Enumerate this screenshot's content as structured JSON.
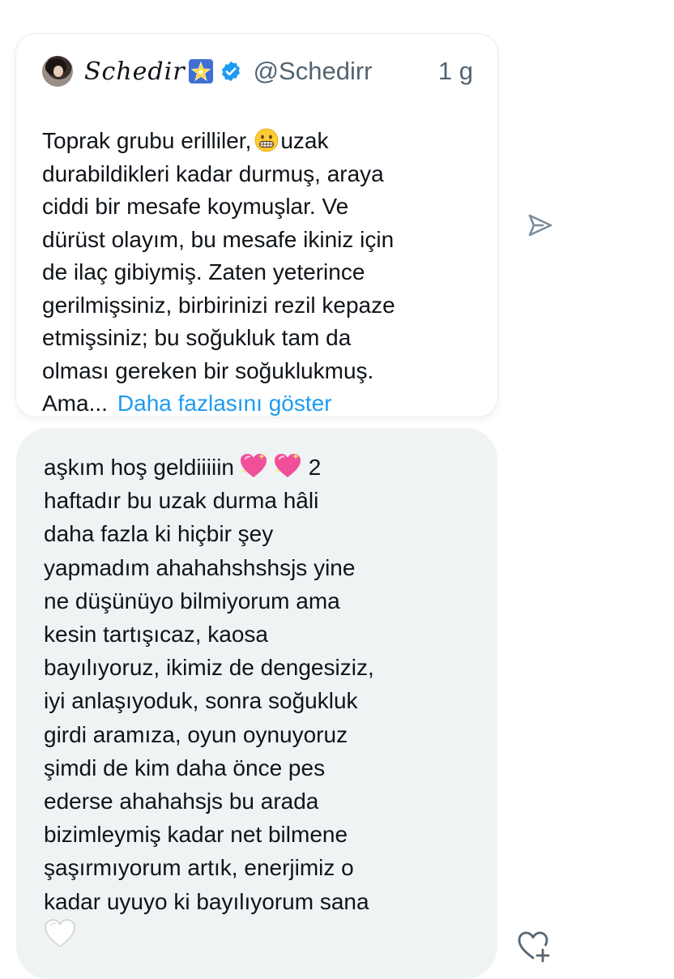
{
  "quote": {
    "display_name": "Schedir",
    "handle": "@Schedirr",
    "time": "1 g",
    "lines": [
      "Toprak grubu erilliler,",
      "uzak",
      "durabildikleri kadar durmuş, araya",
      "ciddi bir mesafe koymuşlar. Ve",
      "dürüst olayım, bu mesafe ikiniz için",
      "de ilaç gibiymiş. Zaten yeterince",
      "gerilmişsiniz, birbirinizi rezil kepaze",
      "etmişsiniz; bu soğukluk tam da",
      "olması gereken bir soğuklukmuş.",
      "Ama..."
    ],
    "show_more": "Daha fazlasını göster"
  },
  "message": {
    "first_line_start": "aşkım hoş geldiiiiin",
    "first_line_end": "2",
    "lines": [
      "haftadır bu uzak durma hâli",
      "daha fazla ki hiçbir şey",
      "yapmadım ahahahshshsjs yine",
      "ne düşünüyo bilmiyorum ama",
      "kesin tartışıcaz, kaosa",
      "bayılıyoruz, ikimiz de dengesiziz,",
      "iyi anlaşıyoduk, sonra soğukluk",
      "girdi aramıza, oyun oynuyoruz",
      "şimdi de kim daha önce pes",
      "ederse ahahahsjs bu arada",
      "bizimleymiş kadar net bilmene",
      "şaşırmıyorum artık, enerjimiz o",
      "kadar uyuyo ki bayılıyorum sana"
    ]
  },
  "icons": {
    "verified": "verified-badge-icon",
    "star": "glowing-star-icon",
    "grimace": "grimacing-face-emoji",
    "sparkling_heart": "sparkling-heart-emoji",
    "white_heart": "white-heart-emoji",
    "share": "send-icon",
    "react": "add-reaction-heart-icon"
  },
  "colors": {
    "link": "#1d9bf0",
    "muted": "#536471",
    "bubble": "#eff3f4",
    "verified": "#1d9bf0"
  }
}
